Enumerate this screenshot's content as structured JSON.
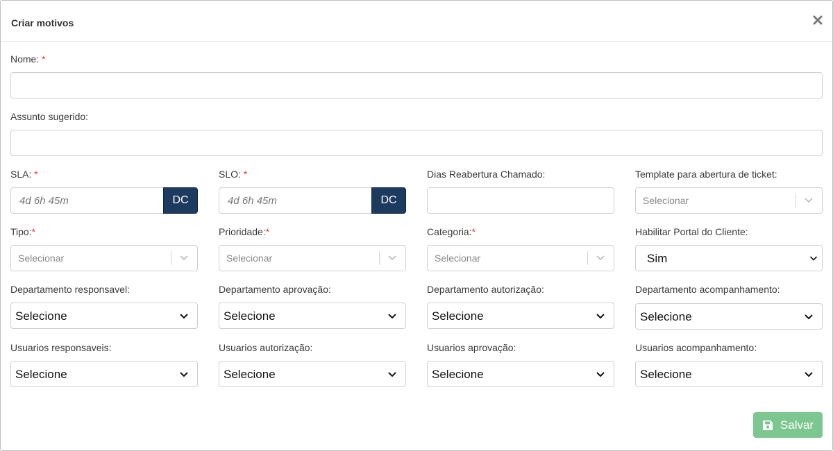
{
  "modal": {
    "title": "Criar motivos",
    "close_icon": "close-icon"
  },
  "fields": {
    "nome": {
      "label": "Nome:",
      "required": "*",
      "value": ""
    },
    "assunto": {
      "label": "Assunto sugerido:",
      "value": ""
    },
    "sla": {
      "label": "SLA:",
      "required": "*",
      "placeholder": "4d 6h 45m",
      "button": "DC"
    },
    "slo": {
      "label": "SLO:",
      "required": "*",
      "placeholder": "4d 6h 45m",
      "button": "DC"
    },
    "dias_reabertura": {
      "label": "Dias Reabertura Chamado:",
      "value": ""
    },
    "template": {
      "label": "Template para abertura de ticket:",
      "placeholder": "Selecionar"
    },
    "tipo": {
      "label": "Tipo:",
      "required": "*",
      "placeholder": "Selecionar"
    },
    "prioridade": {
      "label": "Prioridade:",
      "required": "*",
      "placeholder": "Selecionar"
    },
    "categoria": {
      "label": "Categoria:",
      "required": "*",
      "placeholder": "Selecionar"
    },
    "portal": {
      "label": "Habilitar Portal do Cliente:",
      "value": "Sim"
    },
    "dep_responsavel": {
      "label": "Departamento responsavel:",
      "value": "Selecione"
    },
    "dep_aprovacao": {
      "label": "Departamento aprovação:",
      "value": "Selecione"
    },
    "dep_autorizacao": {
      "label": "Departamento autorização:",
      "value": "Selecione"
    },
    "dep_acompanhamento": {
      "label": "Departamento acompanhamento:",
      "value": "Selecione"
    },
    "usr_responsaveis": {
      "label": "Usuarios responsaveis:",
      "value": "Selecione"
    },
    "usr_autorizacao": {
      "label": "Usuarios autorização:",
      "value": "Selecione"
    },
    "usr_aprovacao": {
      "label": "Usuarios aprovação:",
      "value": "Selecione"
    },
    "usr_acompanhamento": {
      "label": "Usuarios acompanhamento:",
      "value": "Selecione"
    }
  },
  "footer": {
    "save_label": "Salvar",
    "save_icon": "floppy-disk-icon"
  },
  "colors": {
    "dc_button": "#1d3a5f",
    "save_button": "#7cc68f",
    "required": "#e53935"
  }
}
